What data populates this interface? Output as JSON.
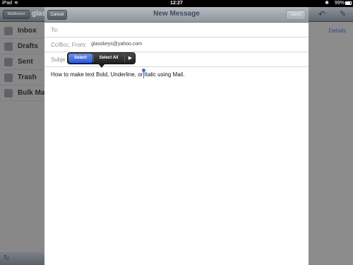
{
  "status_bar": {
    "carrier": "iPad",
    "wifi": "≋",
    "time": "12:27",
    "bluetooth": "✱",
    "battery": "99%"
  },
  "background_mail": {
    "mailboxes_button": "Mailboxes",
    "account_title": "glas",
    "folders": [
      {
        "label": "Inbox",
        "icon": "inbox-icon"
      },
      {
        "label": "Drafts",
        "icon": "drafts-icon"
      },
      {
        "label": "Sent",
        "icon": "sent-icon"
      },
      {
        "label": "Trash",
        "icon": "trash-icon"
      },
      {
        "label": "Bulk Ma",
        "icon": "folder-icon"
      }
    ],
    "details_link": "Details",
    "reply_icon": "↶",
    "compose_icon": "✎",
    "refresh_icon": "↻"
  },
  "compose": {
    "cancel_label": "Cancel",
    "title": "New Message",
    "send_label": "Send",
    "to_label": "To:",
    "ccbcc_label": "Cc/Bcc, From:",
    "from_value": "glasskeys@yahoo.com",
    "subject_label": "Subje",
    "body": "How to make text Bold, Underline, or Italic using Mail."
  },
  "popover": {
    "select": "Select",
    "select_all": "Select All",
    "more": "▶"
  },
  "colors": {
    "accent_blue": "#2d59d8",
    "cursor_blue": "#3b6fd1"
  }
}
